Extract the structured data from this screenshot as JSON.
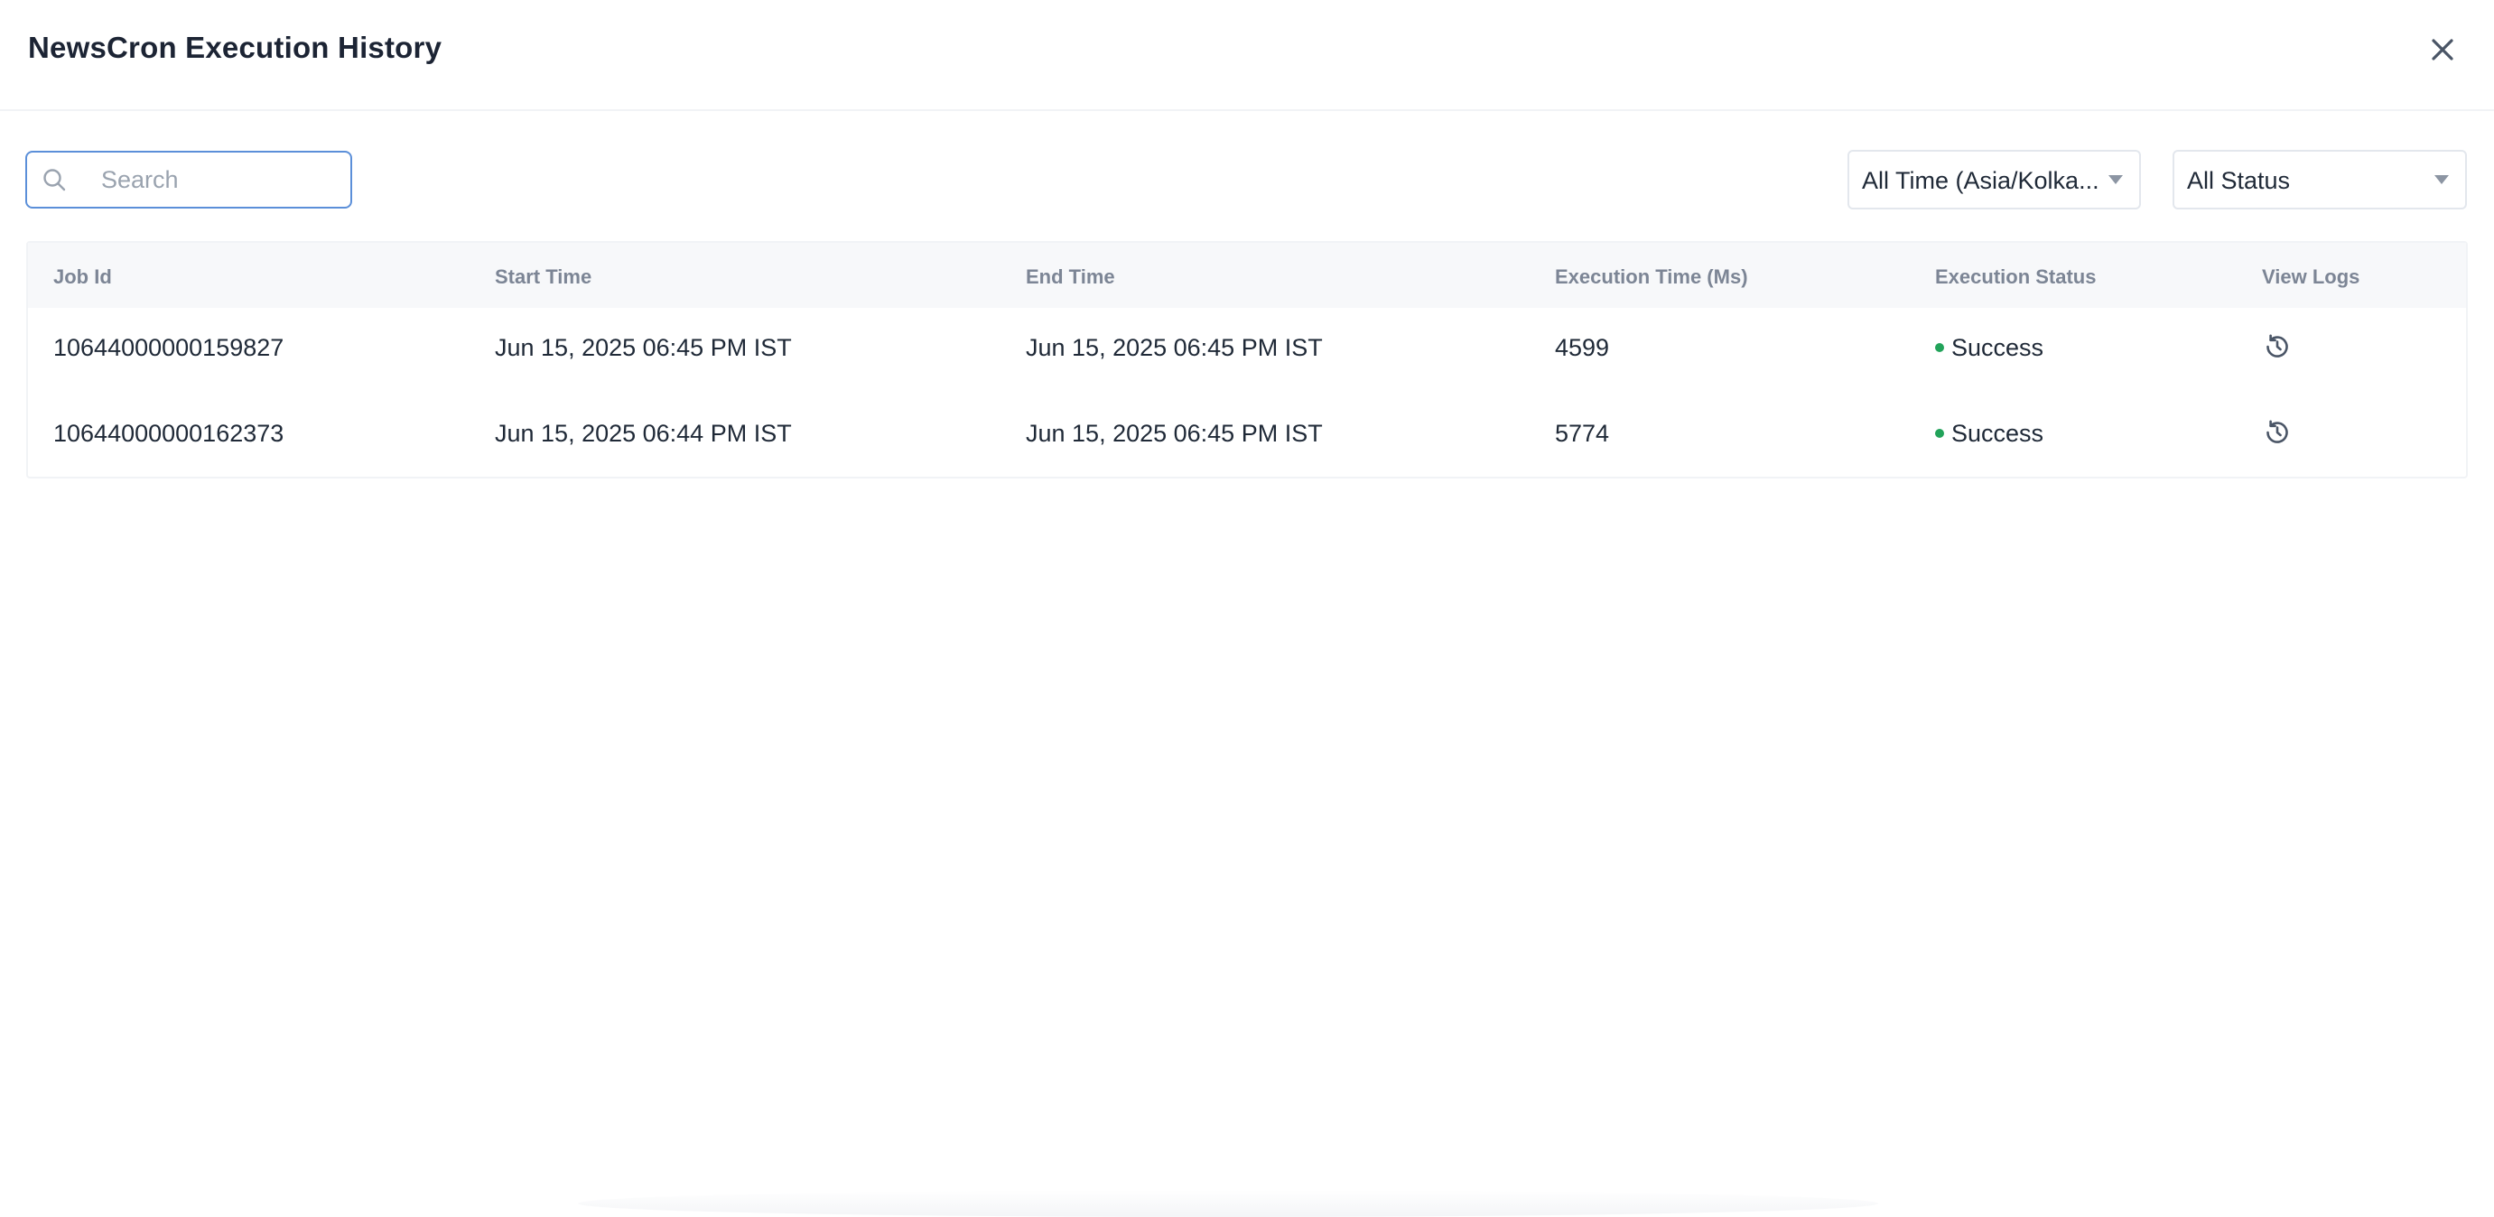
{
  "header": {
    "title": "NewsCron Execution History",
    "close_icon": "close-icon"
  },
  "toolbar": {
    "search": {
      "placeholder": "Search",
      "value": ""
    },
    "time_filter": {
      "selected": "All Time (Asia/Kolka..."
    },
    "status_filter": {
      "selected": "All Status"
    }
  },
  "table": {
    "columns": [
      "Job Id",
      "Start Time",
      "End Time",
      "Execution Time (Ms)",
      "Execution Status",
      "View Logs"
    ],
    "rows": [
      {
        "job_id": "10644000000159827",
        "start_time": "Jun 15, 2025 06:45 PM IST",
        "end_time": "Jun 15, 2025 06:45 PM IST",
        "execution_time": "4599",
        "status": "Success"
      },
      {
        "job_id": "10644000000162373",
        "start_time": "Jun 15, 2025 06:44 PM IST",
        "end_time": "Jun 15, 2025 06:45 PM IST",
        "execution_time": "5774",
        "status": "Success"
      }
    ]
  },
  "colors": {
    "accent": "#5b8fd9",
    "success": "#22a35a",
    "header_bg": "#f7f8fa"
  }
}
